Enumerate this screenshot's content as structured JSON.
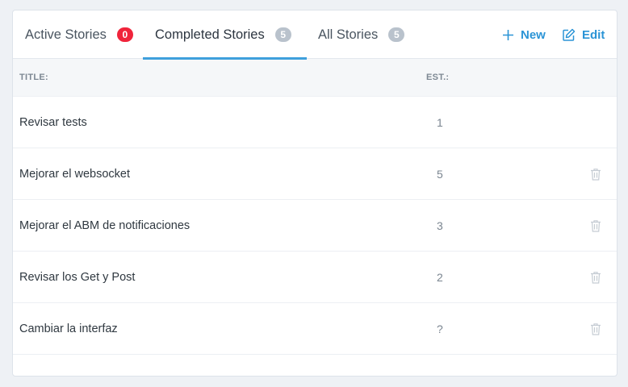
{
  "tabs": [
    {
      "label": "Active Stories",
      "count": "0",
      "active": false
    },
    {
      "label": "Completed Stories",
      "count": "5",
      "active": true
    },
    {
      "label": "All Stories",
      "count": "5",
      "active": false
    }
  ],
  "actions": {
    "new_label": "New",
    "edit_label": "Edit"
  },
  "table": {
    "columns": [
      "TITLE:",
      "EST.:"
    ],
    "rows": [
      {
        "title": "Revisar tests",
        "est": "1",
        "deletable": false
      },
      {
        "title": "Mejorar el websocket",
        "est": "5",
        "deletable": true
      },
      {
        "title": "Mejorar el ABM de notificaciones",
        "est": "3",
        "deletable": true
      },
      {
        "title": "Revisar los Get y Post",
        "est": "2",
        "deletable": true
      },
      {
        "title": "Cambiar la interfaz",
        "est": "?",
        "deletable": true
      }
    ]
  },
  "icons": {
    "new": "plus-icon",
    "edit": "edit-icon",
    "delete": "trash-icon"
  },
  "colors": {
    "accent": "#3fa0dc",
    "link": "#2b94d6",
    "badge_alert": "#f0243b",
    "badge_neutral": "#b9c2cc"
  }
}
